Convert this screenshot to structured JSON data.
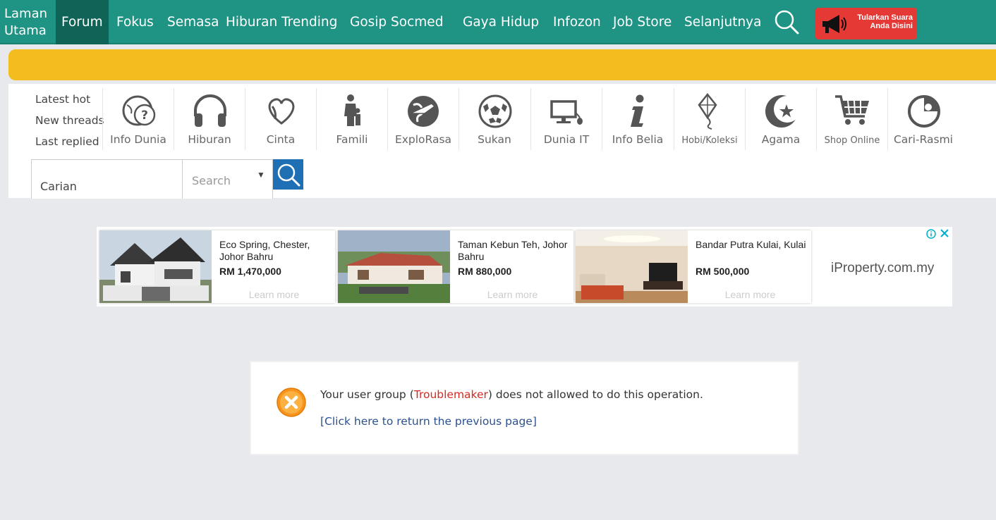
{
  "nav": {
    "home": "Laman Utama",
    "items": [
      "Forum",
      "Fokus",
      "Semasa",
      "Hiburan Trending",
      "Gosip Socmed",
      "Gaya Hidup",
      "Infozon",
      "Job Store",
      "Selanjutnya"
    ],
    "active": "Forum",
    "promo_line1": "Tularkan Suara",
    "promo_line2": "Anda Disini"
  },
  "quick_links": [
    "Latest hot",
    "New threads",
    "Last replied"
  ],
  "categories": [
    {
      "label": "Info Dunia",
      "icon": "globe-question-icon"
    },
    {
      "label": "Hiburan",
      "icon": "headphones-icon"
    },
    {
      "label": "Cinta",
      "icon": "heart-icon"
    },
    {
      "label": "Famili",
      "icon": "family-icon"
    },
    {
      "label": "ExploRasa",
      "icon": "globe-plane-icon"
    },
    {
      "label": "Sukan",
      "icon": "soccer-ball-icon"
    },
    {
      "label": "Dunia IT",
      "icon": "monitor-icon"
    },
    {
      "label": "Info Belia",
      "icon": "info-icon"
    },
    {
      "label": "Hobi/Koleksi",
      "icon": "kite-icon"
    },
    {
      "label": "Agama",
      "icon": "crescent-star-icon"
    },
    {
      "label": "Shop Online",
      "icon": "shopping-cart-icon"
    },
    {
      "label": "Cari-Rasmi",
      "icon": "cari-logo-icon"
    }
  ],
  "search": {
    "value": "Carian",
    "select_label": "Search"
  },
  "ad": {
    "cards": [
      {
        "title": "Eco Spring, Chester, Johor Bahru",
        "price": "RM 1,470,000",
        "cta": "Learn more"
      },
      {
        "title": "Taman Kebun Teh, Johor Bahru",
        "price": "RM 880,000",
        "cta": "Learn more"
      },
      {
        "title": "Bandar Putra Kulai, Kulai",
        "price": "RM 500,000",
        "cta": "Learn more"
      }
    ],
    "brand": "iProperty.com.my"
  },
  "message": {
    "prefix": "Your user group (",
    "group": "Troublemaker",
    "suffix": ") does not allowed to do this operation.",
    "link": "[Click here to return the previous page]"
  },
  "colors": {
    "nav_bg": "#1f9384",
    "nav_active": "#106457",
    "yellow_bar": "#f3bd1f",
    "search_button": "#1e6fb3",
    "promo": "#e53935",
    "error_orange": "#f7941d"
  }
}
